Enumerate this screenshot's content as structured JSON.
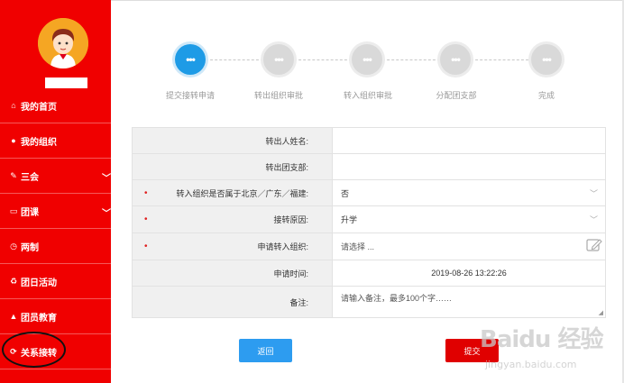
{
  "sidebar": {
    "items": [
      {
        "label": "我的首页",
        "icon": "home-icon",
        "glyph": "⌂"
      },
      {
        "label": "我的组织",
        "icon": "users-icon",
        "glyph": "●"
      },
      {
        "label": "三会",
        "icon": "edit-icon",
        "glyph": "✎",
        "expand": "chevron-down-icon"
      },
      {
        "label": "团课",
        "icon": "folder-icon",
        "glyph": "▭",
        "expand": "chevron-down-icon"
      },
      {
        "label": "两制",
        "icon": "clock-icon",
        "glyph": "◷"
      },
      {
        "label": "团日活动",
        "icon": "recycle-icon",
        "glyph": "♻"
      },
      {
        "label": "团员教育",
        "icon": "graduation-cap-icon",
        "glyph": "▲"
      },
      {
        "label": "关系接转",
        "icon": "refresh-icon",
        "glyph": "⟳"
      }
    ],
    "chevron": "﹀"
  },
  "steps": [
    {
      "label": "提交接转申请",
      "active": true,
      "glyph": "•••"
    },
    {
      "label": "转出组织审批",
      "active": false,
      "glyph": "•••"
    },
    {
      "label": "转入组织审批",
      "active": false,
      "glyph": "•••"
    },
    {
      "label": "分配团支部",
      "active": false,
      "glyph": "•••"
    },
    {
      "label": "完成",
      "active": false,
      "glyph": "•••"
    }
  ],
  "form": {
    "rows": [
      {
        "label": "转出人姓名:",
        "value": "",
        "required": false
      },
      {
        "label": "转出团支部:",
        "value": "",
        "required": false
      },
      {
        "label": "转入组织是否属于北京／广东／福建:",
        "value": "否",
        "required": true,
        "dropdown": true
      },
      {
        "label": "接转原因:",
        "value": "升学",
        "required": true,
        "dropdown": true
      },
      {
        "label": "申请转入组织:",
        "value": "请选择 ...",
        "required": true,
        "edit": true
      },
      {
        "label": "申请时间:",
        "value": "2019-08-26 13:22:26",
        "required": false,
        "center": true
      },
      {
        "label": "备注:",
        "placeholder": "请输入备注，最多100个字……",
        "required": false,
        "textarea": true
      }
    ],
    "required_mark": "•",
    "dropdown_glyph": "﹀"
  },
  "buttons": {
    "back": "返回",
    "submit": "提交"
  },
  "watermark": {
    "text": "Baidu 经验",
    "sub": "jingyan.baidu.com"
  },
  "colors": {
    "sidebar": "#f00000",
    "step_active": "#1e9be6",
    "step_inactive": "#d9d9d9",
    "back_button": "#2d9cf0",
    "submit_button": "#e00000"
  }
}
